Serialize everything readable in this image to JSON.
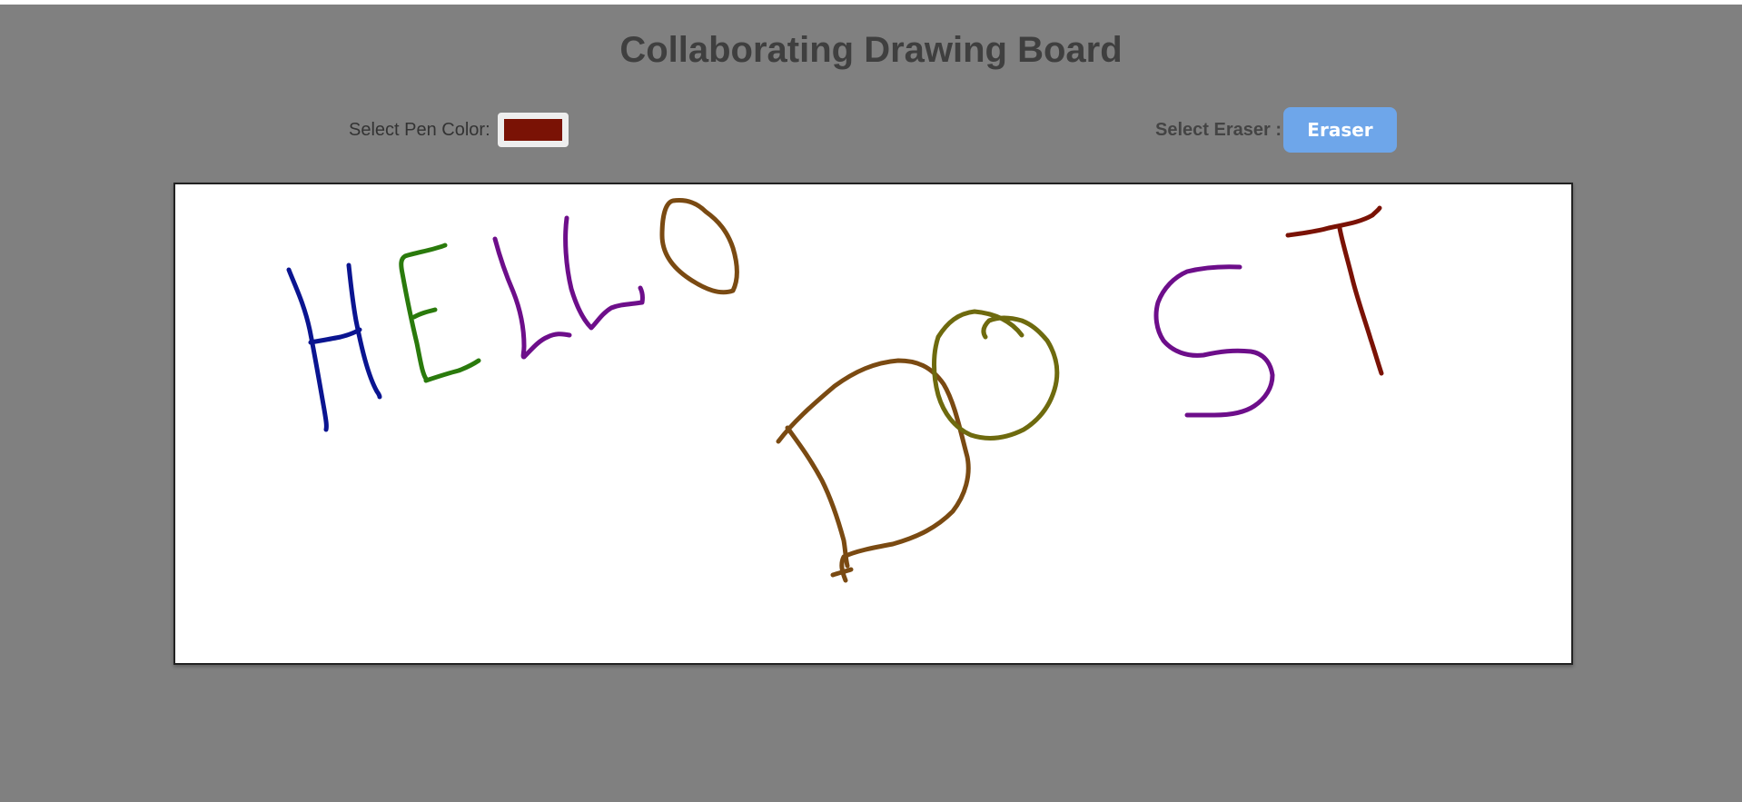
{
  "header": {
    "title": "Collaborating Drawing Board"
  },
  "toolbar": {
    "pen_color_label": "Select Pen Color:",
    "pen_color_value": "#7a1205",
    "eraser_label": "Select Eraser :",
    "eraser_button_label": "Eraser"
  },
  "colors": {
    "page_background": "#808080",
    "canvas_background": "#ffffff",
    "eraser_button": "#6ea6ea",
    "stroke_blue": "#0a1490",
    "stroke_green": "#2a7a0c",
    "stroke_purple": "#6d0e8a",
    "stroke_brown": "#7a4a12",
    "stroke_olive": "#6e6a0e",
    "stroke_darkred": "#7a1205"
  }
}
